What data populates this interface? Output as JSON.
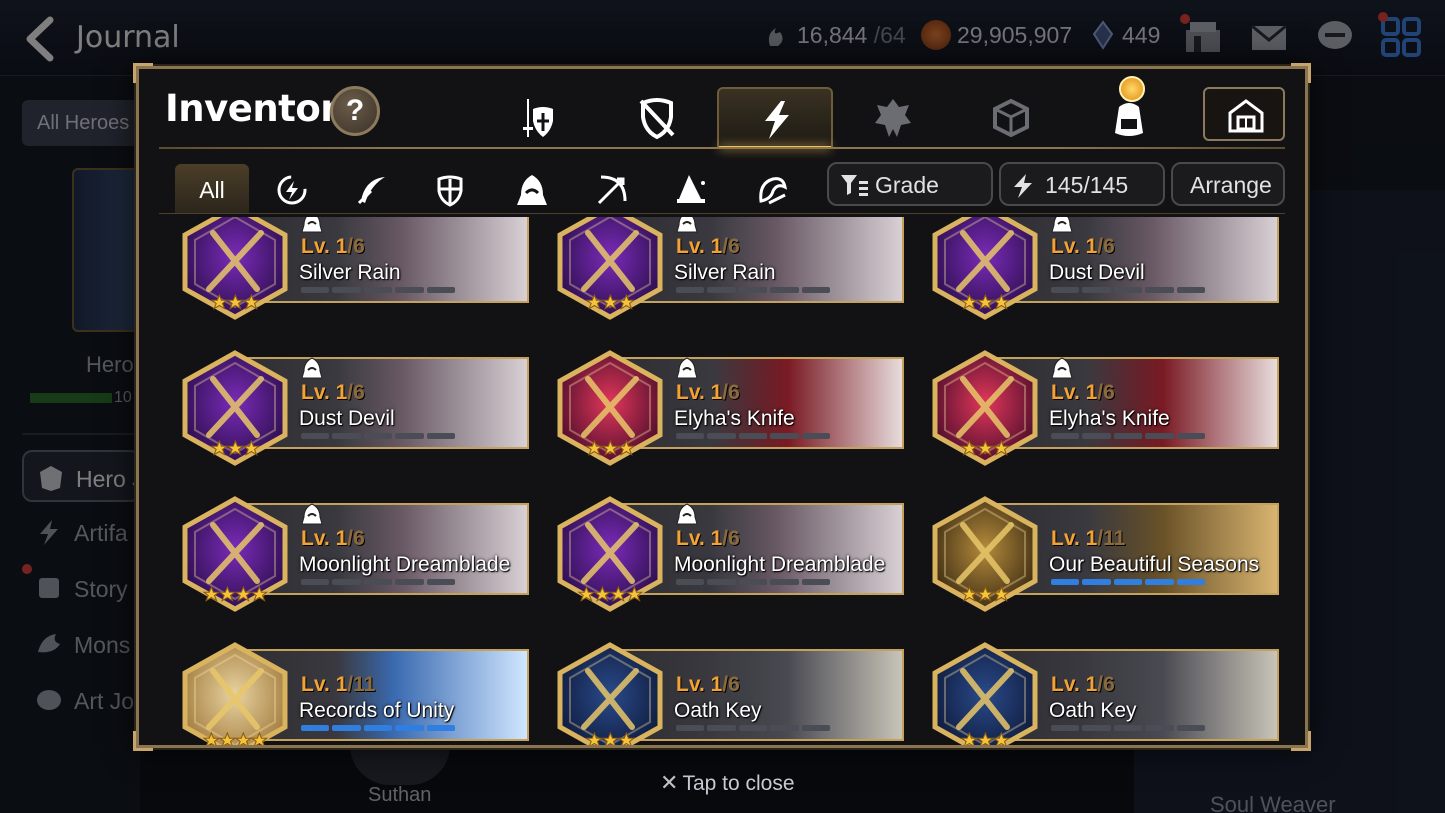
{
  "topbar": {
    "title": "Journal",
    "stamina": "16,844",
    "stamina_max": "/64",
    "gold": "29,905,907",
    "crystals": "449"
  },
  "background": {
    "all_heroes": "All Heroes",
    "hero_label": "Hero",
    "progress_num": "10",
    "side_items": [
      "Hero J",
      "Artifa",
      "Story",
      "Mons",
      "Art Jo"
    ],
    "soul_weaver": "Soul Weaver",
    "portrait_name": "Suthan"
  },
  "modal": {
    "title": "Inventory",
    "help": "?",
    "category_tabs": [
      {
        "name": "equipment",
        "icon": "sword-shield-icon",
        "active": false
      },
      {
        "name": "disabled-equipment",
        "icon": "broken-shield-icon",
        "active": false
      },
      {
        "name": "artifacts",
        "icon": "lightning-icon",
        "active": true
      },
      {
        "name": "catalysts",
        "icon": "crest-icon",
        "active": false
      },
      {
        "name": "materials",
        "icon": "cube-icon",
        "active": false
      },
      {
        "name": "bag",
        "icon": "backpack-icon",
        "active": false
      }
    ],
    "storage_icon": "storage-house-icon",
    "filter_all": "All",
    "filter_tabs": [
      "all",
      "element-icon",
      "feather-icon",
      "shield-icon",
      "hood-icon",
      "bow-icon",
      "wizard-hat-icon",
      "soul-weaver-icon"
    ],
    "grade_label": "Grade",
    "capacity": "145/145",
    "arrange_label": "Arrange",
    "tap_to_close": "Tap to close"
  },
  "colors": {
    "gold_frame": "#c4a25c",
    "level_orange": "#f3a233",
    "bar_blue": "#2f7ee0",
    "accent_active": "#f3c15a"
  },
  "artifacts": [
    {
      "name": "Silver Rain",
      "level": "Lv. 1",
      "max": "/6",
      "stars": 3,
      "class_icon": "hood-icon",
      "bar_filled": false,
      "theme": "purple"
    },
    {
      "name": "Silver Rain",
      "level": "Lv. 1",
      "max": "/6",
      "stars": 3,
      "class_icon": "hood-icon",
      "bar_filled": false,
      "theme": "purple"
    },
    {
      "name": "Dust Devil",
      "level": "Lv. 1",
      "max": "/6",
      "stars": 3,
      "class_icon": "hood-icon",
      "bar_filled": false,
      "theme": "purple"
    },
    {
      "name": "Dust Devil",
      "level": "Lv. 1",
      "max": "/6",
      "stars": 3,
      "class_icon": "hood-icon",
      "bar_filled": false,
      "theme": "purple"
    },
    {
      "name": "Elyha's Knife",
      "level": "Lv. 1",
      "max": "/6",
      "stars": 3,
      "class_icon": "hood-icon",
      "bar_filled": false,
      "theme": "red"
    },
    {
      "name": "Elyha's Knife",
      "level": "Lv. 1",
      "max": "/6",
      "stars": 3,
      "class_icon": "hood-icon",
      "bar_filled": false,
      "theme": "red"
    },
    {
      "name": "Moonlight Dreamblade",
      "level": "Lv. 1",
      "max": "/6",
      "stars": 4,
      "class_icon": "hood-icon",
      "bar_filled": false,
      "theme": "purple"
    },
    {
      "name": "Moonlight Dreamblade",
      "level": "Lv. 1",
      "max": "/6",
      "stars": 4,
      "class_icon": "hood-icon",
      "bar_filled": false,
      "theme": "purple"
    },
    {
      "name": "Our Beautiful Seasons",
      "level": "Lv. 1",
      "max": "/11",
      "stars": 3,
      "class_icon": "",
      "bar_filled": true,
      "theme": "gold"
    },
    {
      "name": "Records of Unity",
      "level": "Lv. 1",
      "max": "/11",
      "stars": 4,
      "class_icon": "",
      "bar_filled": true,
      "theme": "light"
    },
    {
      "name": "Oath Key",
      "level": "Lv. 1",
      "max": "/6",
      "stars": 3,
      "class_icon": "",
      "bar_filled": false,
      "theme": "blue"
    },
    {
      "name": "Oath Key",
      "level": "Lv. 1",
      "max": "/6",
      "stars": 3,
      "class_icon": "",
      "bar_filled": false,
      "theme": "blue"
    }
  ]
}
